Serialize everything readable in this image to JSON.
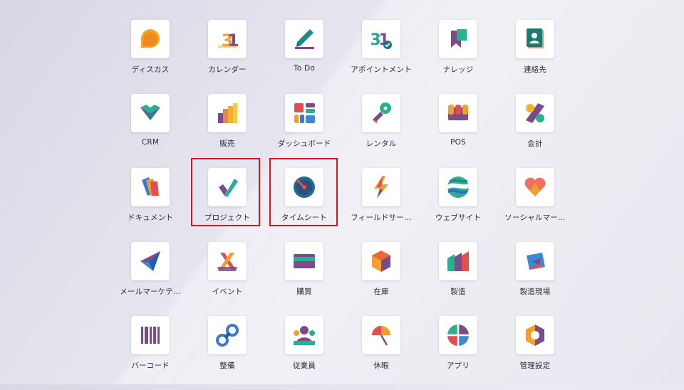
{
  "apps": [
    {
      "label": "ディスカス",
      "icon": "discuss-icon"
    },
    {
      "label": "カレンダー",
      "icon": "calendar-icon"
    },
    {
      "label": "To Do",
      "icon": "todo-icon"
    },
    {
      "label": "アポイントメント",
      "icon": "appointment-icon"
    },
    {
      "label": "ナレッジ",
      "icon": "knowledge-icon"
    },
    {
      "label": "連絡先",
      "icon": "contacts-icon"
    },
    {
      "label": "CRM",
      "icon": "crm-icon"
    },
    {
      "label": "販売",
      "icon": "sales-icon"
    },
    {
      "label": "ダッシュボード",
      "icon": "dashboard-icon"
    },
    {
      "label": "レンタル",
      "icon": "rental-icon"
    },
    {
      "label": "POS",
      "icon": "pos-icon"
    },
    {
      "label": "会計",
      "icon": "accounting-icon"
    },
    {
      "label": "ドキュメント",
      "icon": "documents-icon"
    },
    {
      "label": "プロジェクト",
      "icon": "project-icon"
    },
    {
      "label": "タイムシート",
      "icon": "timesheet-icon"
    },
    {
      "label": "フィールドサー…",
      "icon": "field-service-icon"
    },
    {
      "label": "ウェブサイト",
      "icon": "website-icon"
    },
    {
      "label": "ソーシャルマー…",
      "icon": "social-marketing-icon"
    },
    {
      "label": "メールマーケテ…",
      "icon": "email-marketing-icon"
    },
    {
      "label": "イベント",
      "icon": "events-icon"
    },
    {
      "label": "購買",
      "icon": "purchase-icon"
    },
    {
      "label": "在庫",
      "icon": "inventory-icon"
    },
    {
      "label": "製造",
      "icon": "manufacturing-icon"
    },
    {
      "label": "製造現場",
      "icon": "shop-floor-icon"
    },
    {
      "label": "バーコード",
      "icon": "barcode-icon"
    },
    {
      "label": "整備",
      "icon": "maintenance-icon"
    },
    {
      "label": "従業員",
      "icon": "employees-icon"
    },
    {
      "label": "休暇",
      "icon": "time-off-icon"
    },
    {
      "label": "アプリ",
      "icon": "apps-icon"
    },
    {
      "label": "管理設定",
      "icon": "settings-icon"
    }
  ],
  "highlight_color": "#d3161d"
}
